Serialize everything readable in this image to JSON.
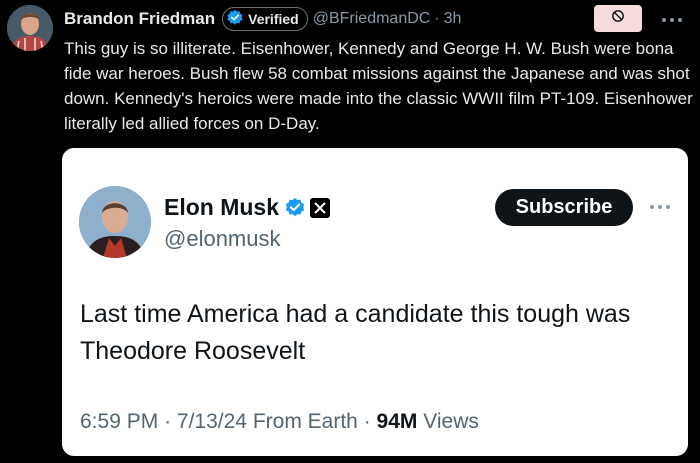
{
  "tweet": {
    "author_name": "Brandon Friedman",
    "verified_label": "Verified",
    "handle": "@BFriedmanDC",
    "separator": "·",
    "time": "3h",
    "text": "This guy is so illiterate. Eisenhower, Kennedy and George H. W. Bush were bona fide war heroes. Bush flew 58 combat missions against the Japanese and was shot down. Kennedy's heroics were made into the classic WWII film PT-109. Eisenhower literally led allied forces on D-Day.",
    "icons": [
      "verified-badge-icon",
      "mute-icon",
      "more-icon"
    ]
  },
  "quoted": {
    "name": "Elon Musk",
    "handle": "@elonmusk",
    "subscribe_label": "Subscribe",
    "text": "Last time America had a candidate this tough was Theodore Roosevelt",
    "time": "6:59 PM",
    "sep1": "·",
    "date": "7/13/24",
    "source": "From Earth",
    "sep2": "·",
    "views_count": "94M",
    "views_label": "Views",
    "icons": [
      "verified-badge-icon",
      "x-logo-icon",
      "more-icon"
    ]
  },
  "colors": {
    "background": "#000000",
    "verified_blue": "#1d9bf0",
    "card_background": "#ffffff",
    "mute_button": "#f6dcdc"
  }
}
